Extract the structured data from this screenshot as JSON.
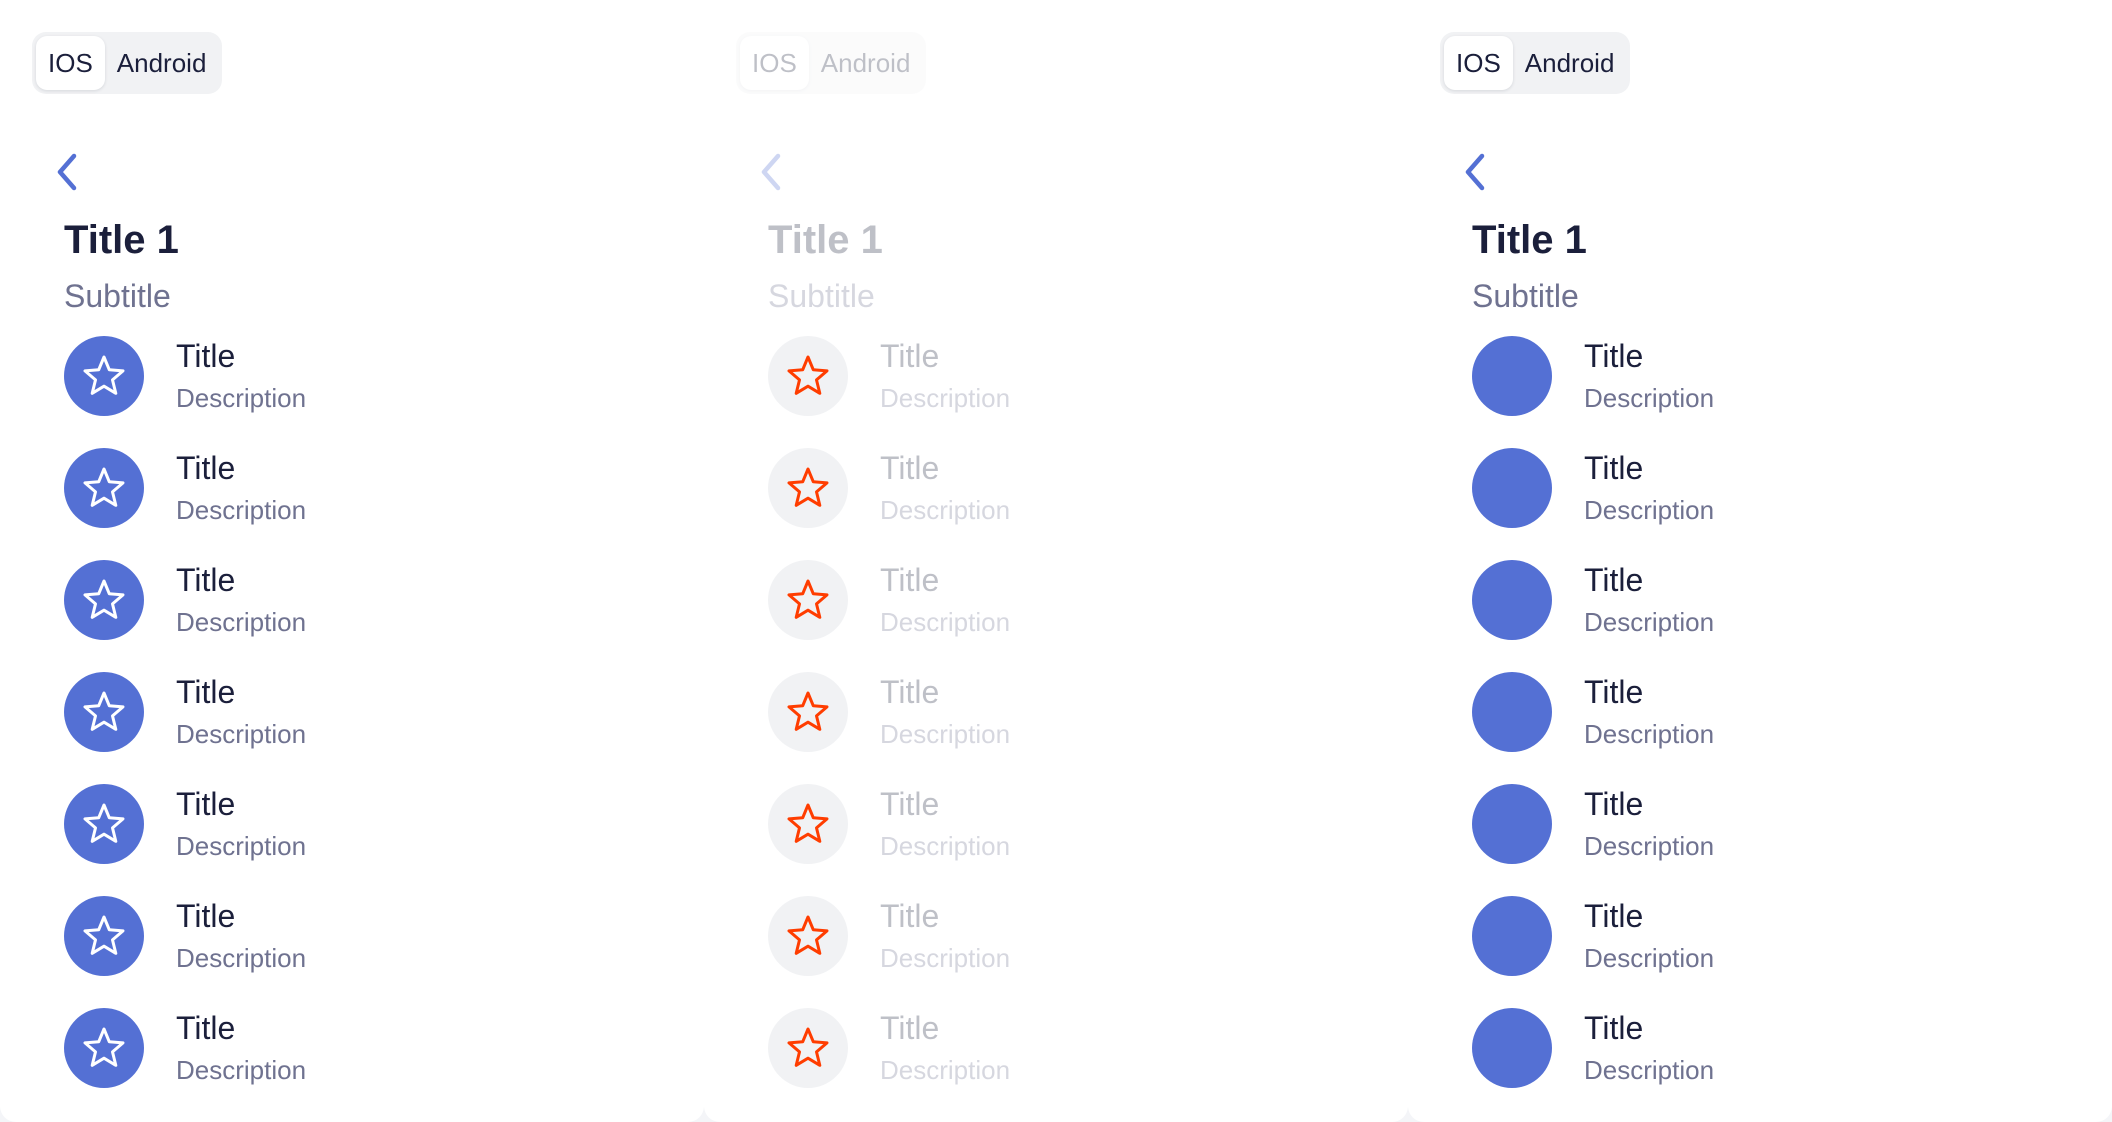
{
  "colors": {
    "accent": "#5470d4",
    "star_outline_orange": "#ff3d00",
    "avatar_neutral": "#f1f2f4",
    "text_primary": "#1b1f3b",
    "text_secondary": "#6f7290"
  },
  "panels": [
    {
      "variant": "accent-star",
      "platform_tabs": [
        {
          "label": "IOS",
          "active": true
        },
        {
          "label": "Android",
          "active": false
        }
      ],
      "back_icon": "chevron-left-icon",
      "title": "Title 1",
      "subtitle": "Subtitle",
      "items": [
        {
          "title": "Title",
          "description": "Description",
          "icon": "star-icon"
        },
        {
          "title": "Title",
          "description": "Description",
          "icon": "star-icon"
        },
        {
          "title": "Title",
          "description": "Description",
          "icon": "star-icon"
        },
        {
          "title": "Title",
          "description": "Description",
          "icon": "star-icon"
        },
        {
          "title": "Title",
          "description": "Description",
          "icon": "star-icon"
        },
        {
          "title": "Title",
          "description": "Description",
          "icon": "star-icon"
        },
        {
          "title": "Title",
          "description": "Description",
          "icon": "star-icon"
        }
      ]
    },
    {
      "variant": "disabled-orange-star",
      "platform_tabs": [
        {
          "label": "IOS",
          "active": true
        },
        {
          "label": "Android",
          "active": false
        }
      ],
      "back_icon": "chevron-left-icon",
      "title": "Title 1",
      "subtitle": "Subtitle",
      "items": [
        {
          "title": "Title",
          "description": "Description",
          "icon": "star-icon"
        },
        {
          "title": "Title",
          "description": "Description",
          "icon": "star-icon"
        },
        {
          "title": "Title",
          "description": "Description",
          "icon": "star-icon"
        },
        {
          "title": "Title",
          "description": "Description",
          "icon": "star-icon"
        },
        {
          "title": "Title",
          "description": "Description",
          "icon": "star-icon"
        },
        {
          "title": "Title",
          "description": "Description",
          "icon": "star-icon"
        },
        {
          "title": "Title",
          "description": "Description",
          "icon": "star-icon"
        }
      ]
    },
    {
      "variant": "accent-empty",
      "platform_tabs": [
        {
          "label": "IOS",
          "active": true
        },
        {
          "label": "Android",
          "active": false
        }
      ],
      "back_icon": "chevron-left-icon",
      "title": "Title 1",
      "subtitle": "Subtitle",
      "items": [
        {
          "title": "Title",
          "description": "Description",
          "icon": "avatar-placeholder"
        },
        {
          "title": "Title",
          "description": "Description",
          "icon": "avatar-placeholder"
        },
        {
          "title": "Title",
          "description": "Description",
          "icon": "avatar-placeholder"
        },
        {
          "title": "Title",
          "description": "Description",
          "icon": "avatar-placeholder"
        },
        {
          "title": "Title",
          "description": "Description",
          "icon": "avatar-placeholder"
        },
        {
          "title": "Title",
          "description": "Description",
          "icon": "avatar-placeholder"
        },
        {
          "title": "Title",
          "description": "Description",
          "icon": "avatar-placeholder"
        }
      ]
    }
  ]
}
